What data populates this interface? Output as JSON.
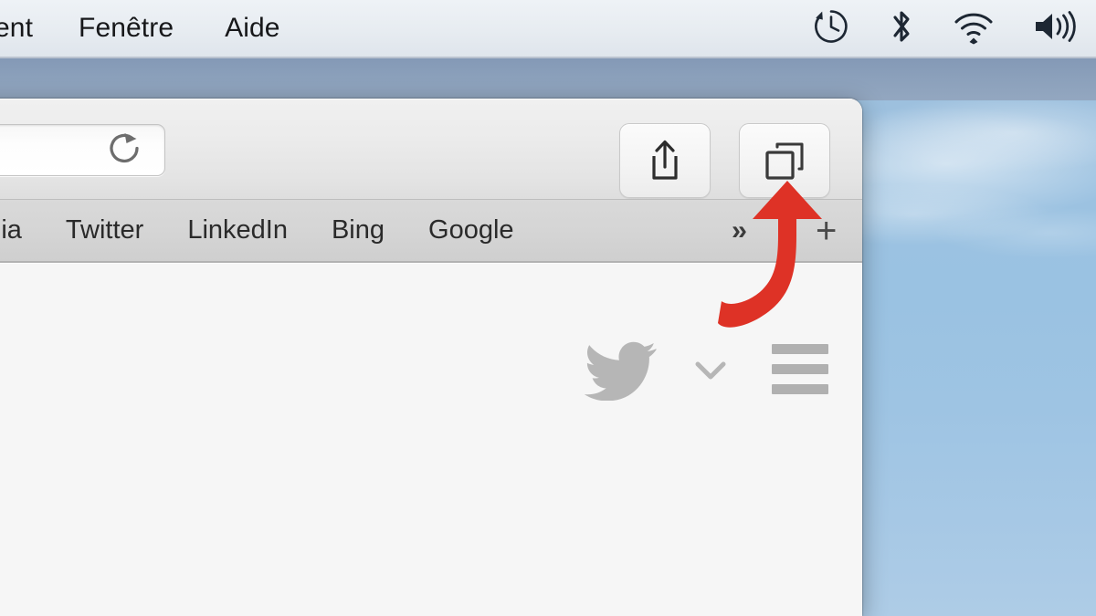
{
  "menubar": {
    "items": [
      {
        "label": "ent",
        "name": "menu-item-truncated"
      },
      {
        "label": "Fenêtre",
        "name": "menu-item-window"
      },
      {
        "label": "Aide",
        "name": "menu-item-help"
      }
    ],
    "status_icons": [
      {
        "name": "time-machine-icon",
        "label": "Time Machine"
      },
      {
        "name": "bluetooth-icon",
        "label": "Bluetooth"
      },
      {
        "name": "wifi-icon",
        "label": "Wi-Fi"
      },
      {
        "name": "volume-icon",
        "label": "Volume"
      }
    ],
    "background_color": "#e7ecf1"
  },
  "browser": {
    "toolbar": {
      "address_bar": {
        "value": "",
        "placeholder": "",
        "reload_icon": "reload-icon"
      },
      "buttons": [
        {
          "name": "share-button",
          "icon": "share-icon",
          "label": "Partager"
        },
        {
          "name": "tabview-button",
          "icon": "tab-overview-icon",
          "label": "Vue d'ensemble des onglets"
        }
      ]
    },
    "bookmarks_bar": {
      "items": [
        {
          "label": "kipedia",
          "name": "bookmark-wikipedia"
        },
        {
          "label": "Twitter",
          "name": "bookmark-twitter"
        },
        {
          "label": "LinkedIn",
          "name": "bookmark-linkedin"
        },
        {
          "label": "Bing",
          "name": "bookmark-bing"
        },
        {
          "label": "Google",
          "name": "bookmark-google"
        }
      ],
      "overflow_label": "››",
      "new_tab_label": "+",
      "background_color": "#d5d5d5"
    },
    "page": {
      "background_color": "#f6f6f6",
      "site": "Twitter",
      "elements": [
        {
          "name": "twitter-bird-logo",
          "label": "Twitter"
        },
        {
          "name": "account-chevron-down-icon",
          "label": "Menu du compte"
        },
        {
          "name": "hamburger-menu-icon",
          "label": "Menu"
        }
      ]
    }
  },
  "annotation": {
    "name": "red-arrow-annotation",
    "color": "#de3226",
    "points_to": "tabview-button",
    "direction": "up-right"
  },
  "desktop": {
    "wallpaper": "blue-sky-with-clouds",
    "sky_top_color": "#9db7d4",
    "sky_bottom_color": "#aecce6"
  }
}
